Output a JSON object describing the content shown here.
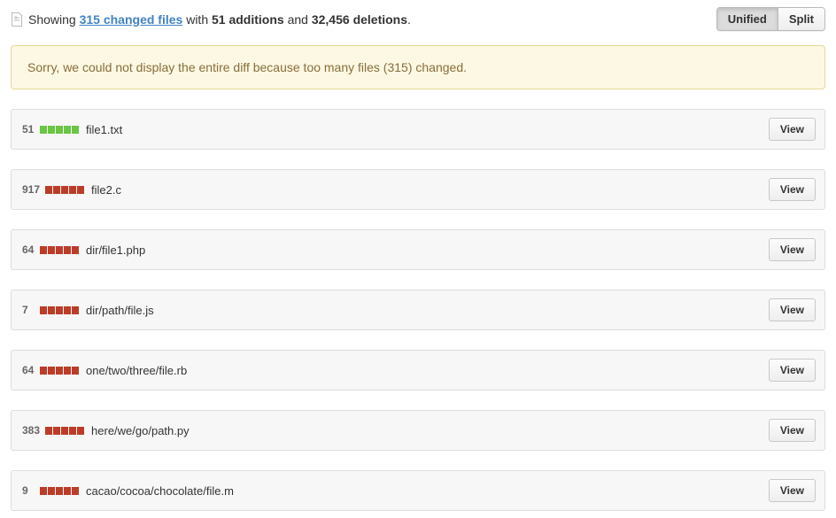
{
  "summary": {
    "prefix": "Showing",
    "changed_files_link": "315 changed files",
    "with": "with",
    "additions": "51",
    "additions_suffix": "additions",
    "and": "and",
    "deletions": "32,456",
    "deletions_suffix": "deletions",
    "period": "."
  },
  "toggle": {
    "unified": "Unified",
    "split": "Split"
  },
  "warning": "Sorry, we could not display the entire diff because too many files (315) changed.",
  "view_label": "View",
  "files": [
    {
      "count": "51",
      "type": "add",
      "name": "file1.txt"
    },
    {
      "count": "917",
      "type": "del",
      "name": "file2.c"
    },
    {
      "count": "64",
      "type": "del",
      "name": "dir/file1.php"
    },
    {
      "count": "7",
      "type": "del",
      "name": "dir/path/file.js"
    },
    {
      "count": "64",
      "type": "del",
      "name": "one/two/three/file.rb"
    },
    {
      "count": "383",
      "type": "del",
      "name": "here/we/go/path.py"
    },
    {
      "count": "9",
      "type": "del",
      "name": "cacao/cocoa/chocolate/file.m"
    }
  ]
}
